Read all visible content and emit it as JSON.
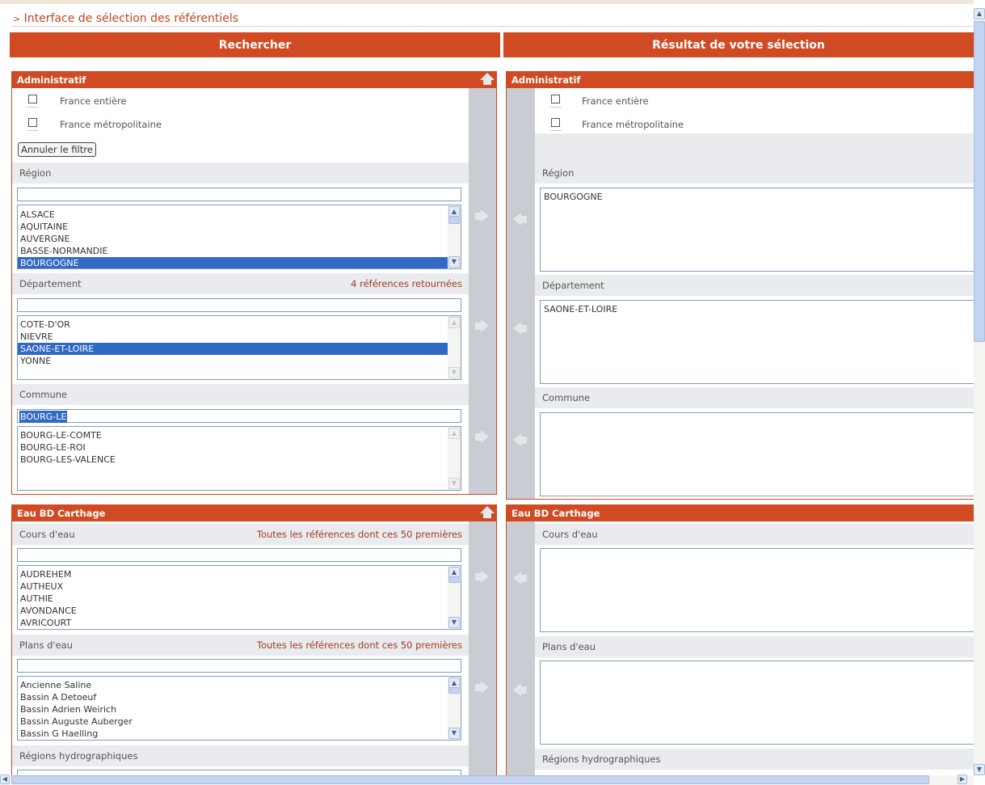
{
  "page": {
    "title_prefix": ">",
    "title": "Interface de sélection des référentiels"
  },
  "search_column": {
    "header": "Rechercher"
  },
  "result_column": {
    "header": "Résultat de votre sélection"
  },
  "admin_panel": {
    "title": "Administratif",
    "checkboxes": [
      "France entière",
      "France métropolitaine"
    ],
    "cancel_filter_button": "Annuler le filtre",
    "region": {
      "label": "Région",
      "search_value": "",
      "items": [
        "ALSACE",
        "AQUITAINE",
        "AUVERGNE",
        "BASSE-NORMANDIE",
        "BOURGOGNE"
      ],
      "selected": "BOURGOGNE"
    },
    "departement": {
      "label": "Département",
      "count": "4 références retournées",
      "search_value": "",
      "items": [
        "COTE-D'OR",
        "NIEVRE",
        "SAONE-ET-LOIRE",
        "YONNE"
      ],
      "selected": "SAONE-ET-LOIRE"
    },
    "commune": {
      "label": "Commune",
      "search_value": "BOURG-LE",
      "items": [
        "BOURG-LE-COMTE",
        "BOURG-LE-ROI",
        "BOURG-LES-VALENCE"
      ]
    }
  },
  "admin_result": {
    "title": "Administratif",
    "checkboxes": [
      "France entière",
      "France métropolitaine"
    ],
    "region": {
      "label": "Région",
      "value": "BOURGOGNE"
    },
    "departement": {
      "label": "Département",
      "value": "SAONE-ET-LOIRE"
    },
    "commune": {
      "label": "Commune",
      "value": ""
    }
  },
  "eau_panel": {
    "title": "Eau BD Carthage",
    "cours_eau": {
      "label": "Cours d'eau",
      "count": "Toutes les références dont ces 50 premières",
      "search_value": "",
      "items": [
        "AUDREHEM",
        "AUTHEUX",
        "AUTHIE",
        "AVONDANCE",
        "AVRICOURT"
      ]
    },
    "plans_eau": {
      "label": "Plans d'eau",
      "count": "Toutes les références dont ces 50 premières",
      "search_value": "",
      "items": [
        "Ancienne Saline",
        "Bassin A Detoeuf",
        "Bassin Adrien Weirich",
        "Bassin Auguste Auberger",
        "Bassin G Haelling"
      ]
    },
    "regions_hydro": {
      "label": "Régions hydrographiques"
    }
  },
  "eau_result": {
    "title": "Eau BD Carthage",
    "cours_eau": {
      "label": "Cours d'eau",
      "value": ""
    },
    "plans_eau": {
      "label": "Plans d'eau",
      "value": ""
    },
    "regions_hydro": {
      "label": "Régions hydrographiques"
    }
  },
  "colors": {
    "accent": "#d04a23",
    "selection": "#316ac5",
    "band": "#e9ebef",
    "gutter": "#c9ccd3"
  }
}
